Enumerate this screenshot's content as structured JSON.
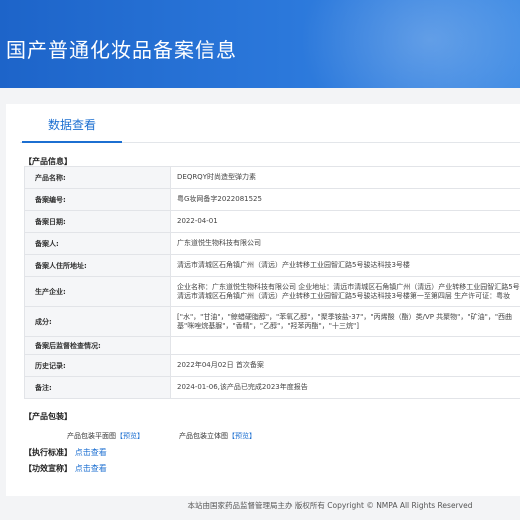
{
  "header": {
    "title": "国产普通化妆品备案信息"
  },
  "tabs": {
    "active": "数据查看"
  },
  "section_product": "【产品信息】",
  "rows": [
    {
      "label": "产品名称:",
      "lines": [
        "DEQRQY时尚造型弹力素"
      ]
    },
    {
      "label": "备案编号:",
      "lines": [
        "粤G妆网备字2022081525"
      ]
    },
    {
      "label": "备案日期:",
      "lines": [
        "2022-04-01"
      ]
    },
    {
      "label": "备案人:",
      "lines": [
        "广东道悦生物科技有限公司"
      ]
    },
    {
      "label": "备案人住所地址:",
      "lines": [
        "清远市清城区石角镇广州（清远）产业转移工业园智汇路5号骏达科技3号楼"
      ]
    },
    {
      "label": "生产企业:",
      "lines": [
        "企业名称：广东道悦生物科技有限公司 企业地址：清远市清城区石角镇广州（清远）产业转移工业园智汇路5号",
        "清远市清城区石角镇广州（清远）产业转移工业园智汇路5号骏达科技3号楼第一至第四层 生产许可证：粤妆"
      ]
    },
    {
      "label": "成分:",
      "lines": [
        "[\"水\"，\"甘油\"，\"鲸蜡硬脂醇\"，\"苯氧乙醇\"，\"聚季铵盐-37\"，\"丙烯酸（酯）类/VP 共聚物\"，\"矿油\"，\"西曲",
        "基\"咪唑烷基脲\"，\"香精\"，\"乙醇\"，\"羟苯丙酯\"，\"十三烷\"]"
      ]
    },
    {
      "label": "备案后监督检查情况:",
      "lines": [
        ""
      ]
    },
    {
      "label": "历史记录:",
      "lines": [
        "2022年04月02日 首次备案"
      ]
    },
    {
      "label": "备注:",
      "lines": [
        "2024-01-06,该产品已完成2023年度报告"
      ]
    }
  ],
  "section_package": "【产品包装】",
  "package": {
    "flat_label": "产品包装平面图",
    "flat_link": "【预览】",
    "solid_label": "产品包装立体图",
    "solid_link": "【预览】"
  },
  "standard": {
    "label": "【执行标准】",
    "link": "点击查看"
  },
  "claims": {
    "label": "【功效宣称】",
    "link": "点击查看"
  },
  "footer": "本站由国家药品监督管理局主办 版权所有 Copyright © NMPA All Rights Reserved"
}
